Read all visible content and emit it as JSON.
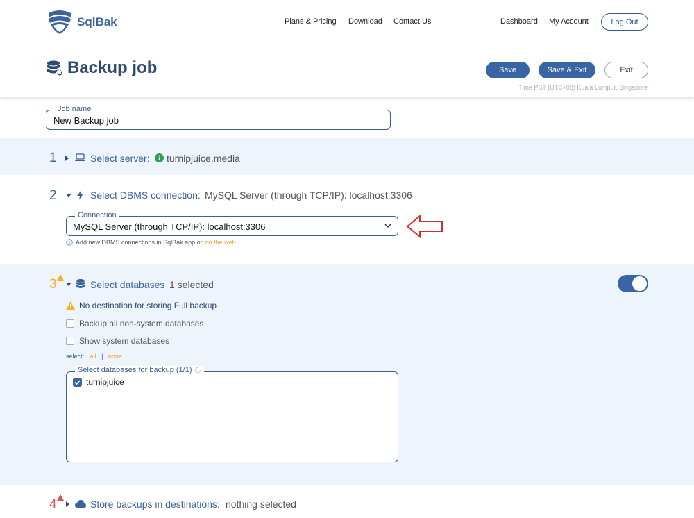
{
  "app": {
    "name": "SqlBak"
  },
  "nav": {
    "plans": "Plans & Pricing",
    "download": "Download",
    "contact": "Contact Us",
    "dashboard": "Dashboard",
    "account": "My Account",
    "logout": "Log Out"
  },
  "page": {
    "title": "Backup job",
    "save": "Save",
    "save_exit": "Save & Exit",
    "exit": "Exit",
    "timezone": "Time PST (UTC+08) Kuala Lumpur, Singapore"
  },
  "job": {
    "legend": "Job name",
    "value": "New Backup job"
  },
  "step1": {
    "num": "1",
    "label": "Select server:",
    "value": "turnipjuice.media"
  },
  "step2": {
    "num": "2",
    "label": "Select DBMS connection:",
    "value": "MySQL Server (through TCP/IP): localhost:3306",
    "connection_legend": "Connection",
    "connection_value": "MySQL Server (through TCP/IP): localhost:3306",
    "hint": "Add new DBMS connections in SqlBak app or",
    "hint_link": "on the web"
  },
  "step3": {
    "num": "3",
    "label": "Select databases",
    "value": "1 selected",
    "warning": "No destination for storing Full backup",
    "option_all_nonsystem": "Backup all non-system databases",
    "option_show_system": "Show system databases",
    "select_label": "select:",
    "select_all": "all",
    "select_sep": "|",
    "select_none": "none",
    "box_legend": "Select databases for backup (1/1)",
    "databases": [
      {
        "name": "turnipjuice",
        "checked": true
      }
    ],
    "toggle_on": true
  },
  "step4": {
    "num": "4",
    "label": "Store backups in destinations:",
    "value": "nothing selected"
  },
  "colors": {
    "accent": "#3a65a5",
    "warning": "#f0b429",
    "error": "#d9534f",
    "link": "#f0a030",
    "arrow": "#d32f2f"
  }
}
